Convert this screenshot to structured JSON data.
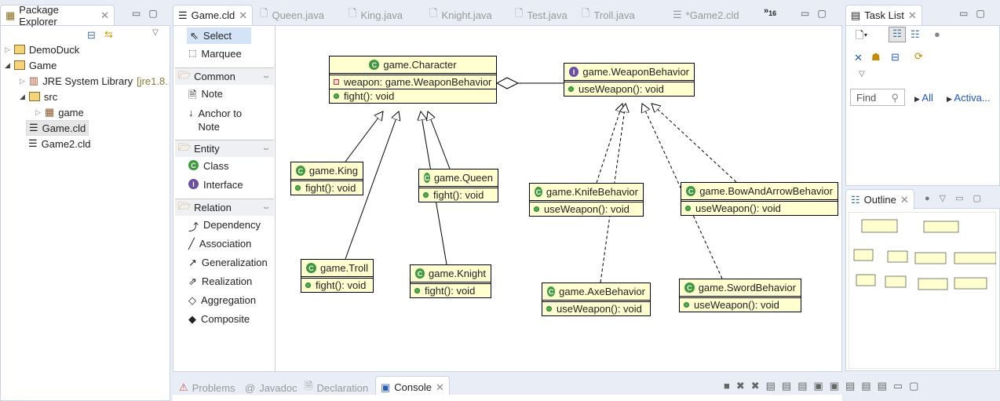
{
  "package_explorer": {
    "title": "Package Explorer",
    "items": [
      {
        "label": "DemoDuck",
        "expanded": false
      },
      {
        "label": "Game",
        "expanded": true
      },
      {
        "label": "JRE System Library",
        "suffix": "[jre1.8."
      },
      {
        "label": "src"
      },
      {
        "label": "game"
      },
      {
        "label": "Game.cld",
        "selected": true
      },
      {
        "label": "Game2.cld"
      }
    ]
  },
  "editor_tabs": [
    {
      "label": "Game.cld",
      "active": true
    },
    {
      "label": "Queen.java"
    },
    {
      "label": "King.java"
    },
    {
      "label": "Knight.java"
    },
    {
      "label": "Test.java"
    },
    {
      "label": "Troll.java"
    },
    {
      "label": "*Game2.cld"
    }
  ],
  "editor_overflow": {
    "symbol": "»",
    "count": "16"
  },
  "palette": {
    "tools": [
      {
        "label": "Select",
        "selected": true
      },
      {
        "label": "Marquee"
      }
    ],
    "groups": [
      {
        "label": "Common",
        "items": [
          "Note",
          "Anchor to Note"
        ]
      },
      {
        "label": "Entity",
        "items": [
          "Class",
          "Interface"
        ]
      },
      {
        "label": "Relation",
        "items": [
          "Dependency",
          "Association",
          "Generalization",
          "Realization",
          "Aggregation",
          "Composite"
        ]
      }
    ]
  },
  "diagram": {
    "classes": {
      "character": {
        "name": "game.Character",
        "kind": "class",
        "attr": "weapon: game.WeaponBehavior",
        "method": "fight(): void"
      },
      "weapon": {
        "name": "game.WeaponBehavior",
        "kind": "interface",
        "method": "useWeapon(): void"
      },
      "king": {
        "name": "game.King",
        "kind": "class",
        "method": "fight(): void"
      },
      "queen": {
        "name": "game.Queen",
        "kind": "class",
        "method": "fight(): void"
      },
      "troll": {
        "name": "game.Troll",
        "kind": "class",
        "method": "fight(): void"
      },
      "knight": {
        "name": "game.Knight",
        "kind": "class",
        "method": "fight(): void"
      },
      "knife": {
        "name": "game.KnifeBehavior",
        "kind": "class",
        "method": "useWeapon(): void"
      },
      "bow": {
        "name": "game.BowAndArrowBehavior",
        "kind": "class",
        "method": "useWeapon(): void"
      },
      "axe": {
        "name": "game.AxeBehavior",
        "kind": "class",
        "method": "useWeapon(): void"
      },
      "sword": {
        "name": "game.SwordBehavior",
        "kind": "class",
        "method": "useWeapon(): void"
      }
    }
  },
  "task_list": {
    "title": "Task List",
    "find_placeholder": "Find",
    "filters": [
      "All",
      "Activa..."
    ]
  },
  "outline": {
    "title": "Outline"
  },
  "bottom_tabs": [
    {
      "label": "Problems"
    },
    {
      "label": "Javadoc"
    },
    {
      "label": "Declaration"
    },
    {
      "label": "Console",
      "active": true
    }
  ]
}
